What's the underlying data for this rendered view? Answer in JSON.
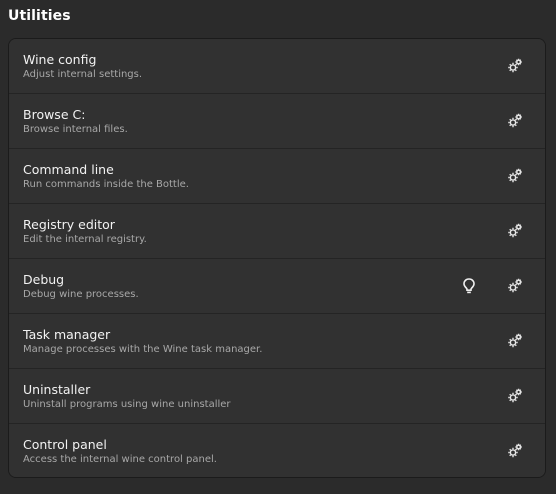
{
  "section": {
    "title": "Utilities"
  },
  "items": [
    {
      "title": "Wine config",
      "subtitle": "Adjust internal settings.",
      "icon": "gears-icon"
    },
    {
      "title": "Browse C:",
      "subtitle": "Browse internal files.",
      "icon": "gears-icon"
    },
    {
      "title": "Command line",
      "subtitle": "Run commands inside the Bottle.",
      "icon": "gears-icon"
    },
    {
      "title": "Registry editor",
      "subtitle": "Edit the internal registry.",
      "icon": "gears-icon"
    },
    {
      "title": "Debug",
      "subtitle": "Debug wine processes.",
      "icon": "gears-icon",
      "extra_icon": "lightbulb-icon"
    },
    {
      "title": "Task manager",
      "subtitle": "Manage processes with the Wine task manager.",
      "icon": "gears-icon"
    },
    {
      "title": "Uninstaller",
      "subtitle": "Uninstall programs using wine uninstaller",
      "icon": "gears-icon"
    },
    {
      "title": "Control panel",
      "subtitle": "Access the internal wine control panel.",
      "icon": "gears-icon"
    }
  ],
  "colors": {
    "background": "#2b2b2b",
    "card": "#313131",
    "title_text": "#f2f2f2",
    "subtitle_text": "#a8a8a8"
  }
}
